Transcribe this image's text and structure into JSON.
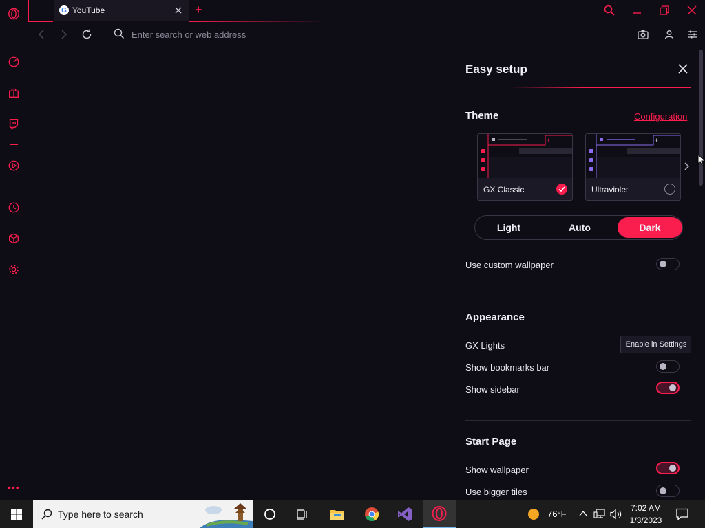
{
  "tab": {
    "title": "YouTube",
    "favicon_letter": "G"
  },
  "address": {
    "placeholder": "Enter search or web address",
    "value": ""
  },
  "panel": {
    "title": "Easy setup",
    "theme": {
      "heading": "Theme",
      "config_link": "Configuration",
      "cards": [
        {
          "label": "GX Classic",
          "selected": true,
          "accent": "#fa1e4e"
        },
        {
          "label": "Ultraviolet",
          "selected": false,
          "accent": "#8b6cf0"
        }
      ],
      "modes": [
        {
          "label": "Light",
          "active": false
        },
        {
          "label": "Auto",
          "active": false
        },
        {
          "label": "Dark",
          "active": true
        }
      ],
      "custom_wallpaper_label": "Use custom wallpaper",
      "custom_wallpaper_on": false
    },
    "appearance": {
      "heading": "Appearance",
      "gx_lights_label": "GX Lights",
      "gx_lights_button": "Enable in Settings",
      "bookmarks_label": "Show bookmarks bar",
      "bookmarks_on": false,
      "sidebar_label": "Show sidebar",
      "sidebar_on": true
    },
    "start_page": {
      "heading": "Start Page",
      "wallpaper_label": "Show wallpaper",
      "wallpaper_on": true,
      "bigger_tiles_label": "Use bigger tiles",
      "bigger_tiles_on": false
    }
  },
  "taskbar": {
    "search_placeholder": "Type here to search",
    "weather": "76°F",
    "time": "7:02 AM",
    "date": "1/3/2023"
  },
  "colors": {
    "accent": "#fa1e4e",
    "background": "#0e0c15"
  }
}
